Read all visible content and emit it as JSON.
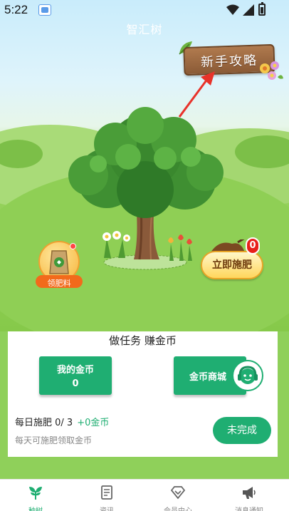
{
  "status_bar": {
    "time": "5:22"
  },
  "header": {
    "title": "智汇树"
  },
  "guide": {
    "label": "新手攻略"
  },
  "fertilizer_bag": {
    "label": "领肥料"
  },
  "fertilize": {
    "label": "立即施肥",
    "badge": "0"
  },
  "tasks": {
    "title": "做任务 赚金币",
    "my_coins_label": "我的金币",
    "my_coins_value": "0",
    "shop_label": "金币商城",
    "daily_label": "每日施肥 0/ 3",
    "daily_reward": "+0金币",
    "daily_hint": "每天可施肥领取金币",
    "status_button": "未完成"
  },
  "bottom_nav": {
    "items": [
      {
        "label": "种树",
        "icon": "sprout-icon",
        "active": true
      },
      {
        "label": "资讯",
        "icon": "news-icon",
        "active": false
      },
      {
        "label": "会员中心",
        "icon": "member-icon",
        "active": false
      },
      {
        "label": "消息通知",
        "icon": "megaphone-icon",
        "active": false
      }
    ]
  },
  "colors": {
    "accent": "#1fae72",
    "badge": "#e8201a",
    "bag_label": "#f26a1b"
  }
}
